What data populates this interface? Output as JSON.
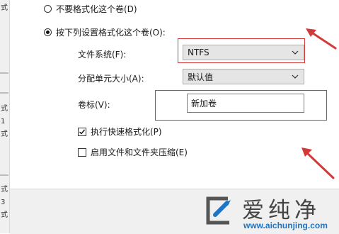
{
  "left_fragments": [
    "式",
    "1",
    "式",
    "式",
    "3",
    "式"
  ],
  "format_options": {
    "no_format": "不要格式化这个卷(D)",
    "format_with": "按下列设置格式化这个卷(O):"
  },
  "file_system": {
    "label": "文件系统(F):",
    "value": "NTFS"
  },
  "allocation_unit": {
    "label": "分配单元大小(A):",
    "value": "默认值"
  },
  "volume_label": {
    "label": "卷标(V):",
    "value": "新加卷"
  },
  "quick_format": {
    "label": "执行快速格式化(P)",
    "checked": true
  },
  "compression": {
    "label": "启用文件和文件夹压缩(E)",
    "checked": false
  },
  "watermark": {
    "title": "爱纯净",
    "url": "www.aichunjing.com"
  },
  "colors": {
    "annotation_red": "#d23a3a",
    "logo_blue": "#1d75c4"
  }
}
